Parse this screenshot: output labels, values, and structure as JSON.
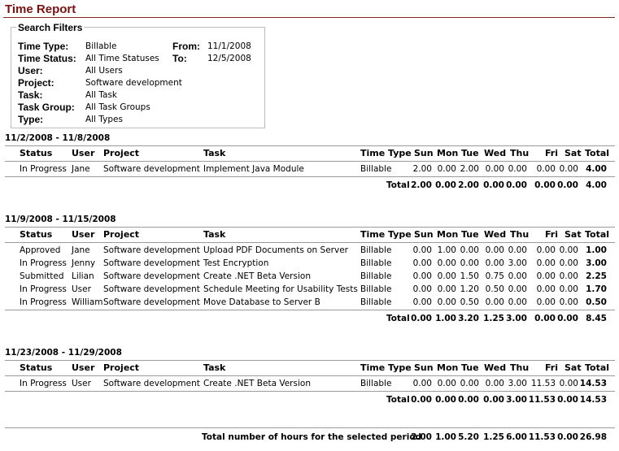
{
  "title": "Time Report",
  "filters": {
    "legend": "Search Filters",
    "rows": [
      {
        "label": "Time Type:",
        "value": "Billable"
      },
      {
        "label": "Time Status:",
        "value": "All Time Statuses"
      },
      {
        "label": "User:",
        "value": "All Users"
      },
      {
        "label": "Project:",
        "value": "Software development"
      },
      {
        "label": "Task:",
        "value": "All Task"
      },
      {
        "label": "Task Group:",
        "value": "All Task Groups"
      },
      {
        "label": "Type:",
        "value": "All Types"
      }
    ],
    "from_label": "From:",
    "from_value": "11/1/2008",
    "to_label": "To:",
    "to_value": "12/5/2008"
  },
  "columns": [
    "Status",
    "User",
    "Project",
    "Task",
    "Time Type",
    "Sun",
    "Mon",
    "Tue",
    "Wed",
    "Thu",
    "Fri",
    "Sat",
    "Total"
  ],
  "weeks": [
    {
      "range": "11/2/2008 - 11/8/2008",
      "rows": [
        {
          "status": "In Progress",
          "user": "Jane",
          "project": "Software development",
          "task": "Implement Java Module",
          "type": "Billable",
          "days": [
            "2.00",
            "0.00",
            "2.00",
            "0.00",
            "0.00",
            "0.00",
            "0.00"
          ],
          "total": "4.00"
        }
      ],
      "totals_label": "Total",
      "totals": [
        "2.00",
        "0.00",
        "2.00",
        "0.00",
        "0.00",
        "0.00",
        "0.00"
      ],
      "grand": "4.00"
    },
    {
      "range": "11/9/2008 - 11/15/2008",
      "rows": [
        {
          "status": "Approved",
          "user": "Jane",
          "project": "Software development",
          "task": "Upload PDF Documents on Server",
          "type": "Billable",
          "days": [
            "0.00",
            "1.00",
            "0.00",
            "0.00",
            "0.00",
            "0.00",
            "0.00"
          ],
          "total": "1.00"
        },
        {
          "status": "In Progress",
          "user": "Jenny",
          "project": "Software development",
          "task": "Test Encryption",
          "type": "Billable",
          "days": [
            "0.00",
            "0.00",
            "0.00",
            "0.00",
            "3.00",
            "0.00",
            "0.00"
          ],
          "total": "3.00"
        },
        {
          "status": "Submitted",
          "user": "Lilian",
          "project": "Software development",
          "task": "Create .NET Beta Version",
          "type": "Billable",
          "days": [
            "0.00",
            "0.00",
            "1.50",
            "0.75",
            "0.00",
            "0.00",
            "0.00"
          ],
          "total": "2.25"
        },
        {
          "status": "In Progress",
          "user": "User",
          "project": "Software development",
          "task": "Schedule Meeting for Usability Tests",
          "type": "Billable",
          "days": [
            "0.00",
            "0.00",
            "1.20",
            "0.50",
            "0.00",
            "0.00",
            "0.00"
          ],
          "total": "1.70"
        },
        {
          "status": "In Progress",
          "user": "William",
          "project": "Software development",
          "task": "Move Database to Server B",
          "type": "Billable",
          "days": [
            "0.00",
            "0.00",
            "0.50",
            "0.00",
            "0.00",
            "0.00",
            "0.00"
          ],
          "total": "0.50"
        }
      ],
      "totals_label": "Total",
      "totals": [
        "0.00",
        "1.00",
        "3.20",
        "1.25",
        "3.00",
        "0.00",
        "0.00"
      ],
      "grand": "8.45"
    },
    {
      "range": "11/23/2008 - 11/29/2008",
      "rows": [
        {
          "status": "In Progress",
          "user": "User",
          "project": "Software development",
          "task": "Create .NET Beta Version",
          "type": "Billable",
          "days": [
            "0.00",
            "0.00",
            "0.00",
            "0.00",
            "3.00",
            "11.53",
            "0.00"
          ],
          "total": "14.53"
        }
      ],
      "totals_label": "Total",
      "totals": [
        "0.00",
        "0.00",
        "0.00",
        "0.00",
        "3.00",
        "11.53",
        "0.00"
      ],
      "grand": "14.53"
    }
  ],
  "period": {
    "label": "Total number of hours for the selected period",
    "totals": [
      "2.00",
      "1.00",
      "5.20",
      "1.25",
      "6.00",
      "11.53",
      "0.00"
    ],
    "grand": "26.98"
  },
  "colors": {
    "title": "#7b1111",
    "rule": "#9a9a9a"
  }
}
